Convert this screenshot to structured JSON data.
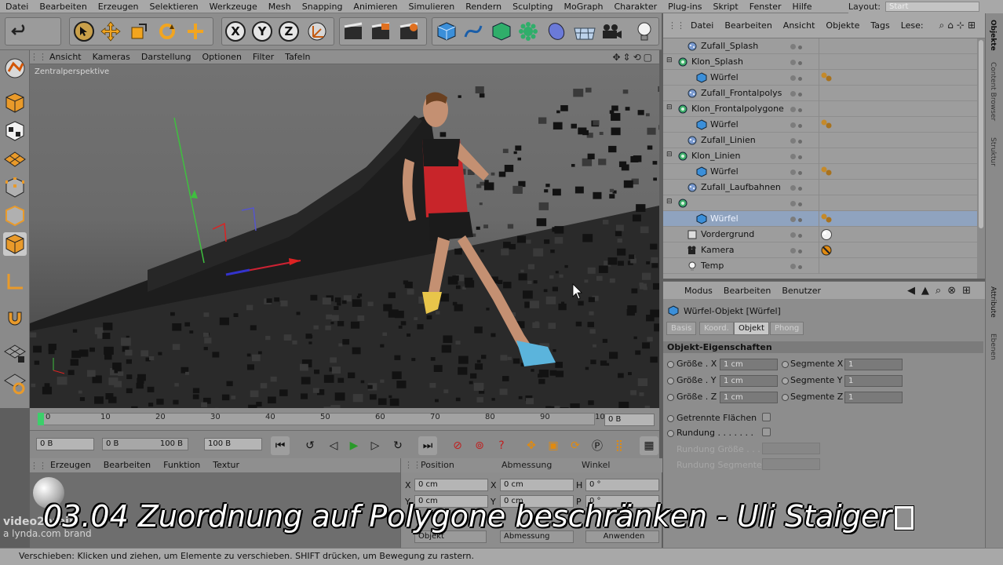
{
  "menubar": {
    "items": [
      "Datei",
      "Bearbeiten",
      "Erzeugen",
      "Selektieren",
      "Werkzeuge",
      "Mesh",
      "Snapping",
      "Animieren",
      "Simulieren",
      "Rendern",
      "Sculpting",
      "MoGraph",
      "Charakter",
      "Plug-ins",
      "Skript",
      "Fenster",
      "Hilfe"
    ],
    "layout_label": "Layout:",
    "layout_value": "Start"
  },
  "toolbar": {
    "axis_x": "X",
    "axis_y": "Y",
    "axis_z": "Z",
    "icons": [
      "undo-icon",
      "select-icon",
      "move-icon",
      "scale-icon",
      "rotate-icon",
      "move-plus-icon",
      "axis-x-icon",
      "axis-y-icon",
      "axis-z-icon",
      "coord-system-icon",
      "render-region-icon",
      "render-view-icon",
      "render-settings-icon",
      "cube-icon",
      "spline-icon",
      "generator-icon",
      "mograph-icon",
      "deformer-icon",
      "floor-icon",
      "camera-icon",
      "light-icon"
    ]
  },
  "viewport": {
    "menu": [
      "Ansicht",
      "Kameras",
      "Darstellung",
      "Optionen",
      "Filter",
      "Tafeln"
    ],
    "label": "Zentralperspektive"
  },
  "timeline": {
    "ticks": [
      "0",
      "10",
      "20",
      "30",
      "40",
      "50",
      "60",
      "70",
      "80",
      "90",
      "10"
    ],
    "frame_field": "0 B"
  },
  "transport": {
    "start_field": "0 B",
    "range_left": "0 B",
    "range_right": "100 B",
    "end_field": "100 B"
  },
  "material": {
    "menu": [
      "Erzeugen",
      "Bearbeiten",
      "Funktion",
      "Textur"
    ]
  },
  "coords": {
    "headers": [
      "Position",
      "Abmessung",
      "Winkel"
    ],
    "rows": [
      {
        "a": "X",
        "av": "0 cm",
        "b": "X",
        "bv": "0 cm",
        "c": "H",
        "cv": "0 °"
      },
      {
        "a": "Y",
        "av": "0 cm",
        "b": "Y",
        "bv": "0 cm",
        "c": "P",
        "cv": "0 °"
      }
    ],
    "mode_left": "Objekt",
    "mode_right": "Abmessung",
    "apply": "Anwenden"
  },
  "objmgr": {
    "menu": [
      "Datei",
      "Bearbeiten",
      "Ansicht",
      "Objekte",
      "Tags",
      "Lese:"
    ],
    "items": [
      {
        "name": "Zufall_Splash",
        "indent": 1,
        "icon": "random-effector-icon",
        "tag": ""
      },
      {
        "name": "Klon_Splash",
        "indent": 0,
        "icon": "cloner-icon",
        "tag": ""
      },
      {
        "name": "Würfel",
        "indent": 2,
        "icon": "cube-icon",
        "tag": "material-tag-icon"
      },
      {
        "name": "Zufall_Frontalpolys",
        "indent": 1,
        "icon": "random-effector-icon",
        "tag": ""
      },
      {
        "name": "Klon_Frontalpolygone",
        "indent": 0,
        "icon": "cloner-icon",
        "tag": ""
      },
      {
        "name": "Würfel",
        "indent": 2,
        "icon": "cube-icon",
        "tag": "material-tag-icon"
      },
      {
        "name": "Zufall_Linien",
        "indent": 1,
        "icon": "random-effector-icon",
        "tag": ""
      },
      {
        "name": "Klon_Linien",
        "indent": 0,
        "icon": "cloner-icon",
        "tag": ""
      },
      {
        "name": "Würfel",
        "indent": 2,
        "icon": "cube-icon",
        "tag": "material-tag-icon"
      },
      {
        "name": "Zufall_Laufbahnen",
        "indent": 1,
        "icon": "random-effector-icon",
        "tag": ""
      },
      {
        "name": "",
        "indent": 0,
        "icon": "cloner-icon",
        "tag": ""
      },
      {
        "name": "Würfel",
        "indent": 2,
        "icon": "cube-icon",
        "tag": "material-tag-icon",
        "selected": true
      },
      {
        "name": "Vordergrund",
        "indent": 1,
        "icon": "background-icon",
        "tag": "sphere-material-icon"
      },
      {
        "name": "Kamera",
        "indent": 1,
        "icon": "camera-icon",
        "tag": "protection-tag-icon"
      },
      {
        "name": "Temp",
        "indent": 1,
        "icon": "light-icon",
        "tag": ""
      }
    ]
  },
  "attr": {
    "menu": [
      "Modus",
      "Bearbeiten",
      "Benutzer"
    ],
    "title": "Würfel-Objekt [Würfel]",
    "tabs": [
      "Basis",
      "Koord.",
      "Objekt",
      "Phong"
    ],
    "section": "Objekt-Eigenschaften",
    "size_x_label": "Größe . X",
    "size_y_label": "Größe . Y",
    "size_z_label": "Größe . Z",
    "size_x": "1 cm",
    "size_y": "1 cm",
    "size_z": "1 cm",
    "seg_x_label": "Segmente X",
    "seg_y_label": "Segmente Y",
    "seg_z_label": "Segmente Z",
    "seg_x": "1",
    "seg_y": "1",
    "seg_z": "1",
    "separate_label": "Getrennte Flächen",
    "fillet_label": "Rundung . . . . . . .",
    "fillet_size_label": "Rundung Größe . . .",
    "fillet_seg_label": "Rundung Segmente"
  },
  "rightstrip": {
    "tabs": [
      "Objekte",
      "Content Browser",
      "Struktur",
      "Attribute",
      "Ebenen"
    ]
  },
  "status": "Verschieben: Klicken und ziehen, um Elemente zu verschieben. SHIFT drücken, um Bewegung zu rastern.",
  "caption": "03.04 Zuordnung auf Polygone beschränken - Uli Staiger",
  "watermark": {
    "line1": "video2brain",
    "line2": "a lynda.com brand"
  }
}
